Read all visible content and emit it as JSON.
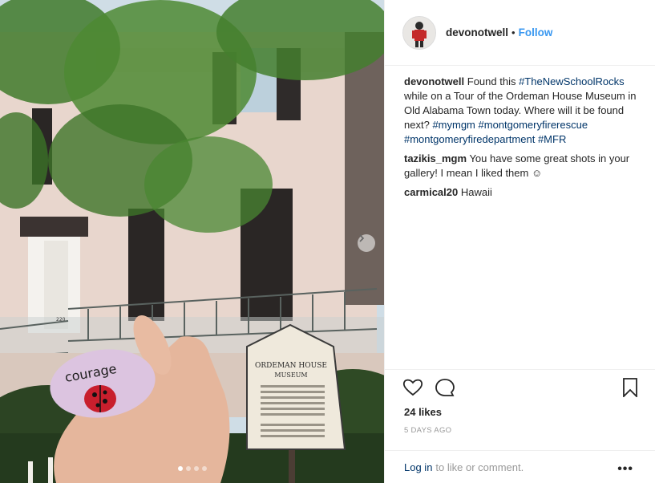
{
  "post": {
    "username": "devonotwell",
    "separator": "•",
    "follow_label": "Follow",
    "caption": {
      "username": "devonotwell",
      "text_start": "Found this",
      "hashtag_1": "#TheNewSchoolRocks",
      "text_mid": "while on a Tour of the Ordeman House Museum in Old Alabama Town today. Where will it be found next?",
      "hashtags_2": [
        "#mymgm",
        "#montgomeryfirerescue",
        "#montgomeryfiredepartment",
        "#MFR"
      ]
    },
    "comments": [
      {
        "username": "tazikis_mgm",
        "text": "You have some great shots in your gallery! I mean I liked them ☺"
      },
      {
        "username": "carmical20",
        "text": "Hawaii"
      }
    ],
    "likes": "24 likes",
    "time": "5 DAYS AGO",
    "login_link": "Log in",
    "login_text": "to like or comment.",
    "more": "•••"
  },
  "photo": {
    "rock_text": "courage",
    "sign_title": "ORDEMAN HOUSE",
    "sign_subtitle": "MUSEUM",
    "door_number": "220",
    "carousel_count": 4,
    "carousel_active": 1
  },
  "colors": {
    "accent": "#3897f0",
    "link": "#003569",
    "muted": "#999999"
  }
}
